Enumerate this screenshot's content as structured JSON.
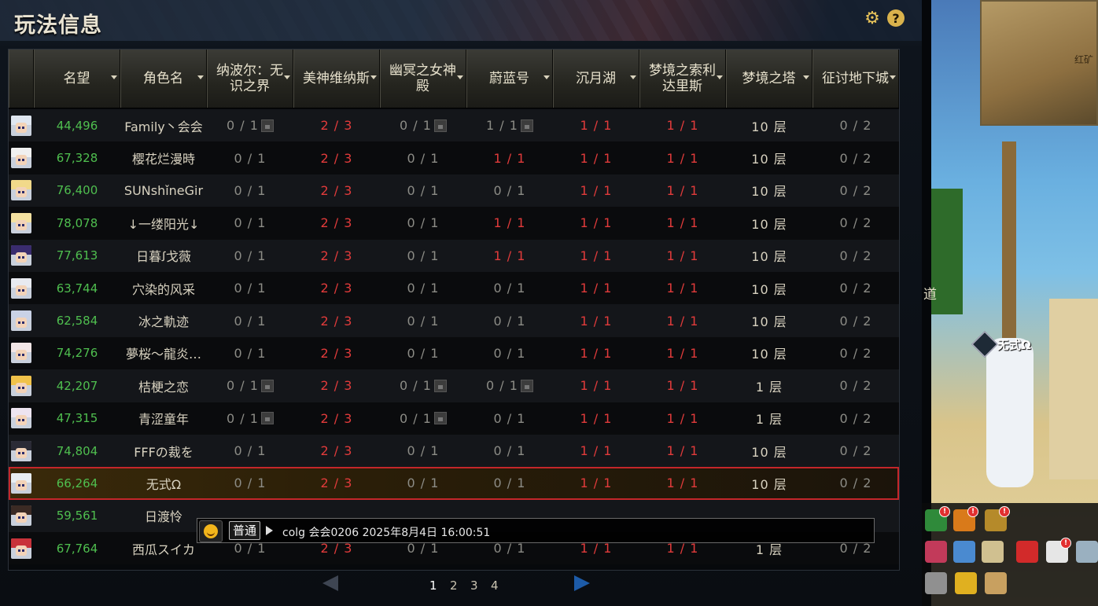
{
  "panel": {
    "title": "玩法信息"
  },
  "icons": {
    "settings": "gear-icon",
    "help": "help-icon",
    "help_glyph": "?"
  },
  "table": {
    "columns": [
      {
        "label": "",
        "sortable": false
      },
      {
        "label": "名望",
        "sortable": true
      },
      {
        "label": "角色名",
        "sortable": true
      },
      {
        "label": "纳波尔：无识之界",
        "sortable": true
      },
      {
        "label": "美神维纳斯",
        "sortable": true
      },
      {
        "label": "幽冥之女神殿",
        "sortable": true
      },
      {
        "label": "蔚蓝号",
        "sortable": true
      },
      {
        "label": "沉月湖",
        "sortable": true
      },
      {
        "label": "梦境之索利达里斯",
        "sortable": true
      },
      {
        "label": "梦境之塔",
        "sortable": true
      },
      {
        "label": "征讨地下城",
        "sortable": true
      }
    ],
    "rows": [
      {
        "avatar": "#dfe6f0",
        "fame": "44,496",
        "name": "Family丶会会",
        "cells": [
          {
            "v": "0 / 1",
            "c": "grey",
            "lock": true
          },
          {
            "v": "2 / 3",
            "c": "red"
          },
          {
            "v": "0 / 1",
            "c": "grey",
            "lock": true
          },
          {
            "v": "1 / 1",
            "c": "grey",
            "lock": true
          },
          {
            "v": "1 / 1",
            "c": "red"
          },
          {
            "v": "1 / 1",
            "c": "red"
          },
          {
            "v": "10 层",
            "c": "white"
          },
          {
            "v": "0 / 2",
            "c": "grey"
          }
        ]
      },
      {
        "avatar": "#f0f0f0",
        "fame": "67,328",
        "name": "樱花烂漫時",
        "cells": [
          {
            "v": "0 / 1",
            "c": "grey"
          },
          {
            "v": "2 / 3",
            "c": "red"
          },
          {
            "v": "0 / 1",
            "c": "grey"
          },
          {
            "v": "1 / 1",
            "c": "red"
          },
          {
            "v": "1 / 1",
            "c": "red"
          },
          {
            "v": "1 / 1",
            "c": "red"
          },
          {
            "v": "10 层",
            "c": "white"
          },
          {
            "v": "0 / 2",
            "c": "grey"
          }
        ]
      },
      {
        "avatar": "#f1d98a",
        "fame": "76,400",
        "name": "SUNshǐneGir",
        "cells": [
          {
            "v": "0 / 1",
            "c": "grey"
          },
          {
            "v": "2 / 3",
            "c": "red"
          },
          {
            "v": "0 / 1",
            "c": "grey"
          },
          {
            "v": "0 / 1",
            "c": "grey"
          },
          {
            "v": "1 / 1",
            "c": "red"
          },
          {
            "v": "1 / 1",
            "c": "red"
          },
          {
            "v": "10 层",
            "c": "white"
          },
          {
            "v": "0 / 2",
            "c": "grey"
          }
        ]
      },
      {
        "avatar": "#f4e1a0",
        "fame": "78,078",
        "name": "↓一缕阳光↓",
        "cells": [
          {
            "v": "0 / 1",
            "c": "grey"
          },
          {
            "v": "2 / 3",
            "c": "red"
          },
          {
            "v": "0 / 1",
            "c": "grey"
          },
          {
            "v": "1 / 1",
            "c": "red"
          },
          {
            "v": "1 / 1",
            "c": "red"
          },
          {
            "v": "1 / 1",
            "c": "red"
          },
          {
            "v": "10 层",
            "c": "white"
          },
          {
            "v": "0 / 2",
            "c": "grey"
          }
        ]
      },
      {
        "avatar": "#3a2c6e",
        "fame": "77,613",
        "name": "日暮ꭍ戈薇",
        "cells": [
          {
            "v": "0 / 1",
            "c": "grey"
          },
          {
            "v": "2 / 3",
            "c": "red"
          },
          {
            "v": "0 / 1",
            "c": "grey"
          },
          {
            "v": "1 / 1",
            "c": "red"
          },
          {
            "v": "1 / 1",
            "c": "red"
          },
          {
            "v": "1 / 1",
            "c": "red"
          },
          {
            "v": "10 层",
            "c": "white"
          },
          {
            "v": "0 / 2",
            "c": "grey"
          }
        ]
      },
      {
        "avatar": "#e8eaf0",
        "fame": "63,744",
        "name": "穴染的风采",
        "cells": [
          {
            "v": "0 / 1",
            "c": "grey"
          },
          {
            "v": "2 / 3",
            "c": "red"
          },
          {
            "v": "0 / 1",
            "c": "grey"
          },
          {
            "v": "0 / 1",
            "c": "grey"
          },
          {
            "v": "1 / 1",
            "c": "red"
          },
          {
            "v": "1 / 1",
            "c": "red"
          },
          {
            "v": "10 层",
            "c": "white"
          },
          {
            "v": "0 / 2",
            "c": "grey"
          }
        ]
      },
      {
        "avatar": "#c9d2e6",
        "fame": "62,584",
        "name": "冰之軌迹",
        "cells": [
          {
            "v": "0 / 1",
            "c": "grey"
          },
          {
            "v": "2 / 3",
            "c": "red"
          },
          {
            "v": "0 / 1",
            "c": "grey"
          },
          {
            "v": "0 / 1",
            "c": "grey"
          },
          {
            "v": "1 / 1",
            "c": "red"
          },
          {
            "v": "1 / 1",
            "c": "red"
          },
          {
            "v": "10 层",
            "c": "white"
          },
          {
            "v": "0 / 2",
            "c": "grey"
          }
        ]
      },
      {
        "avatar": "#f2e6e6",
        "fame": "74,276",
        "name": "夢桜～龍炎…",
        "cells": [
          {
            "v": "0 / 1",
            "c": "grey"
          },
          {
            "v": "2 / 3",
            "c": "red"
          },
          {
            "v": "0 / 1",
            "c": "grey"
          },
          {
            "v": "0 / 1",
            "c": "grey"
          },
          {
            "v": "1 / 1",
            "c": "red"
          },
          {
            "v": "1 / 1",
            "c": "red"
          },
          {
            "v": "10 层",
            "c": "white"
          },
          {
            "v": "0 / 2",
            "c": "grey"
          }
        ]
      },
      {
        "avatar": "#f0c24a",
        "fame": "42,207",
        "name": "桔梗之恋",
        "cells": [
          {
            "v": "0 / 1",
            "c": "grey",
            "lock": true
          },
          {
            "v": "2 / 3",
            "c": "red"
          },
          {
            "v": "0 / 1",
            "c": "grey",
            "lock": true
          },
          {
            "v": "0 / 1",
            "c": "grey",
            "lock": true
          },
          {
            "v": "1 / 1",
            "c": "red"
          },
          {
            "v": "1 / 1",
            "c": "red"
          },
          {
            "v": "1 层",
            "c": "white"
          },
          {
            "v": "0 / 2",
            "c": "grey"
          }
        ]
      },
      {
        "avatar": "#ede4f0",
        "fame": "47,315",
        "name": "青涩童年",
        "cells": [
          {
            "v": "0 / 1",
            "c": "grey",
            "lock": true
          },
          {
            "v": "2 / 3",
            "c": "red"
          },
          {
            "v": "0 / 1",
            "c": "grey",
            "lock": true
          },
          {
            "v": "0 / 1",
            "c": "grey"
          },
          {
            "v": "1 / 1",
            "c": "red"
          },
          {
            "v": "1 / 1",
            "c": "red"
          },
          {
            "v": "1 层",
            "c": "white"
          },
          {
            "v": "0 / 2",
            "c": "grey"
          }
        ]
      },
      {
        "avatar": "#2b2b36",
        "fame": "74,804",
        "name": "FFFの裁を",
        "cells": [
          {
            "v": "0 / 1",
            "c": "grey"
          },
          {
            "v": "2 / 3",
            "c": "red"
          },
          {
            "v": "0 / 1",
            "c": "grey"
          },
          {
            "v": "0 / 1",
            "c": "grey"
          },
          {
            "v": "1 / 1",
            "c": "red"
          },
          {
            "v": "1 / 1",
            "c": "red"
          },
          {
            "v": "10 层",
            "c": "white"
          },
          {
            "v": "0 / 2",
            "c": "grey"
          }
        ]
      },
      {
        "avatar": "#e9eef2",
        "fame": "66,264",
        "name": "无式Ω",
        "selected": true,
        "cells": [
          {
            "v": "0 / 1",
            "c": "grey"
          },
          {
            "v": "2 / 3",
            "c": "red"
          },
          {
            "v": "0 / 1",
            "c": "grey"
          },
          {
            "v": "0 / 1",
            "c": "grey"
          },
          {
            "v": "1 / 1",
            "c": "red"
          },
          {
            "v": "1 / 1",
            "c": "red"
          },
          {
            "v": "10 层",
            "c": "white"
          },
          {
            "v": "0 / 2",
            "c": "grey"
          }
        ]
      },
      {
        "avatar": "#3b2a24",
        "fame": "59,561",
        "name": "日渡怜",
        "cells": [
          {
            "v": "",
            "c": "grey"
          },
          {
            "v": "",
            "c": "red"
          },
          {
            "v": "",
            "c": "grey"
          },
          {
            "v": "",
            "c": "grey"
          },
          {
            "v": "",
            "c": "red"
          },
          {
            "v": "",
            "c": "red"
          },
          {
            "v": "",
            "c": "white"
          },
          {
            "v": "",
            "c": "grey"
          }
        ]
      },
      {
        "avatar": "#c8323a",
        "fame": "67,764",
        "name": "西瓜スイカ",
        "cells": [
          {
            "v": "0 / 1",
            "c": "grey"
          },
          {
            "v": "2 / 3",
            "c": "red"
          },
          {
            "v": "0 / 1",
            "c": "grey"
          },
          {
            "v": "0 / 1",
            "c": "grey"
          },
          {
            "v": "1 / 1",
            "c": "red"
          },
          {
            "v": "1 / 1",
            "c": "red"
          },
          {
            "v": "1 层",
            "c": "white"
          },
          {
            "v": "0 / 2",
            "c": "grey"
          }
        ]
      }
    ]
  },
  "pager": {
    "pages": [
      "1",
      "2",
      "3",
      "4"
    ],
    "current": "1"
  },
  "chat": {
    "channel": "普通",
    "message": "colg 会会0206 2025年8月4日 16:00:51"
  },
  "scene": {
    "minimap_label": "红矿",
    "player_name": "无式Ω",
    "npc_fragment": "道"
  },
  "colors": {
    "fame": "#4fbf4f",
    "red_value": "#e23b3b",
    "grey_value": "#8c8c86",
    "selected_border": "#c4262a",
    "next_arrow": "#1d5ba8"
  }
}
